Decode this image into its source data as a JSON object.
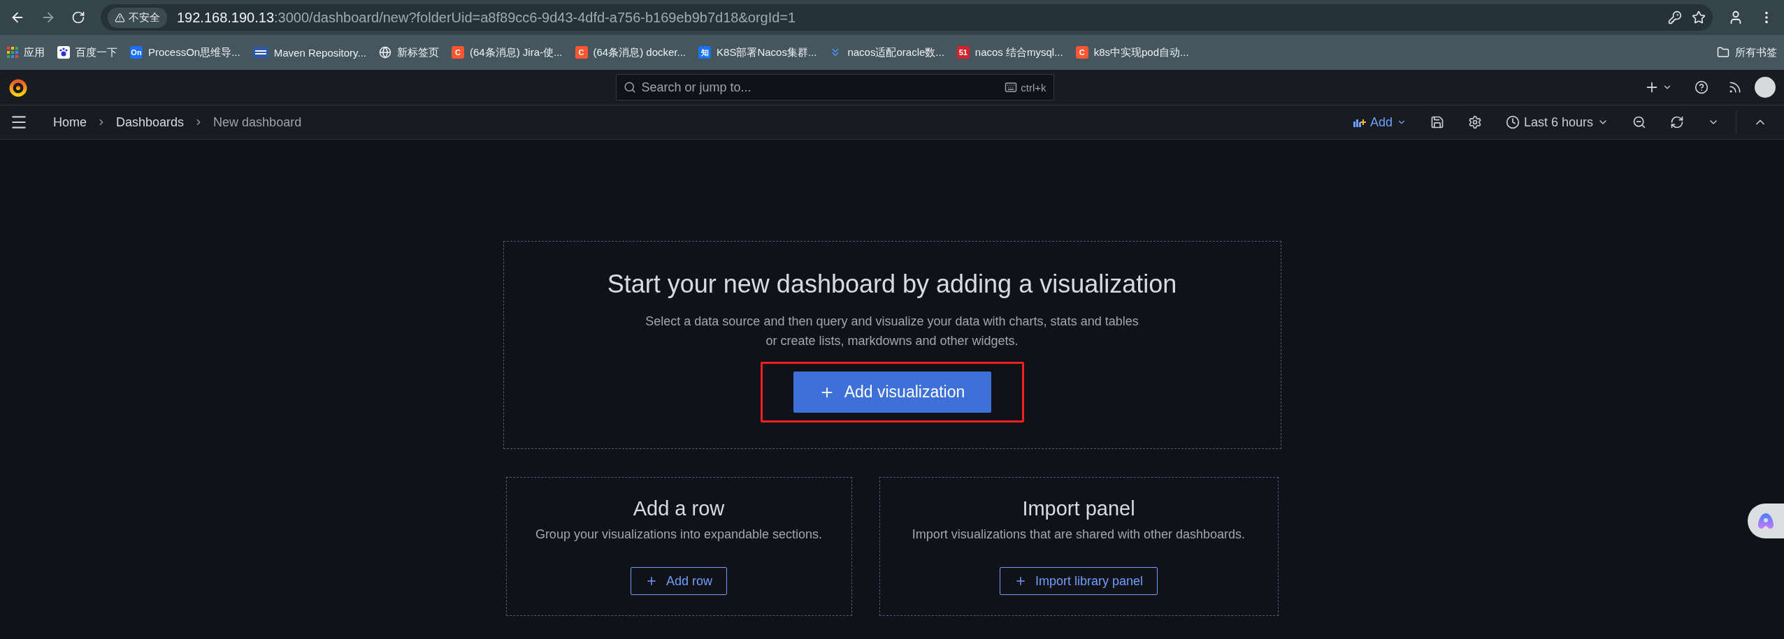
{
  "browser": {
    "security": "不安全",
    "url_host": "192.168.190.13",
    "url_path": ":3000/dashboard/new?folderUid=a8f89cc6-9d43-4dfd-a756-b169eb9b7d18&orgId=1",
    "bookmarks": [
      {
        "kind": "apps",
        "label": "应用"
      },
      {
        "kind": "paw",
        "label": "百度一下"
      },
      {
        "kind": "badge",
        "badge": "On",
        "color": "#1a6ff5",
        "label": "ProcessOn思维导..."
      },
      {
        "kind": "maven",
        "label": "Maven Repository..."
      },
      {
        "kind": "globe",
        "label": "新标签页"
      },
      {
        "kind": "badge",
        "badge": "C",
        "color": "#fc5531",
        "label": "(64条消息) Jira-使..."
      },
      {
        "kind": "badge",
        "badge": "C",
        "color": "#fc5531",
        "label": "(64条消息) docker..."
      },
      {
        "kind": "badge",
        "badge": "知",
        "color": "#1772f6",
        "label": "K8S部署Nacos集群..."
      },
      {
        "kind": "chevrons",
        "label": "nacos适配oracle数..."
      },
      {
        "kind": "badge",
        "badge": "51",
        "color": "#d7202a",
        "label": "nacos 结合mysql..."
      },
      {
        "kind": "badge",
        "badge": "C",
        "color": "#fc5531",
        "label": "k8s中实现pod自动..."
      }
    ],
    "all_bookmarks": "所有书签"
  },
  "topbar": {
    "search": {
      "placeholder": "Search or jump to...",
      "shortcut": "ctrl+k"
    }
  },
  "breadcrumbs": [
    {
      "label": "Home",
      "current": false
    },
    {
      "label": "Dashboards",
      "current": false
    },
    {
      "label": "New dashboard",
      "current": true
    }
  ],
  "toolbar": {
    "add": "Add",
    "time_range": "Last 6 hours"
  },
  "empty_state": {
    "title": "Start your new dashboard by adding a visualization",
    "lines": [
      "Select a data source and then query and visualize your data with charts, stats and tables",
      "or create lists, markdowns and other widgets."
    ],
    "button": {
      "label": "Add visualization",
      "highlighted": true
    }
  },
  "cards": [
    {
      "title": "Add a row",
      "text": "Group your visualizations into expandable sections.",
      "button": "Add row"
    },
    {
      "title": "Import panel",
      "text": "Import visualizations that are shared with other dashboards.",
      "button": "Import library panel"
    }
  ]
}
